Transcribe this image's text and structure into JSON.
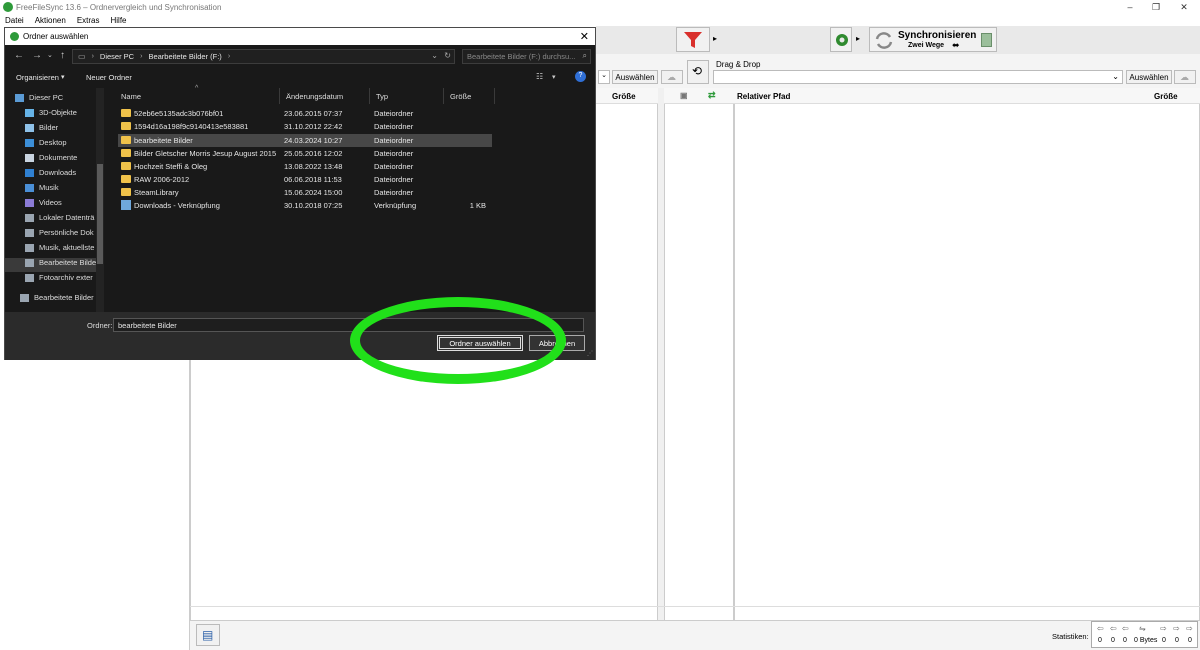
{
  "app": {
    "title": "FreeFileSync 13.6 – Ordnervergleich und Synchronisation",
    "menu": [
      "Datei",
      "Aktionen",
      "Extras",
      "Hilfe"
    ],
    "window_controls": {
      "minimize": "–",
      "maximize": "❐",
      "close": "✕"
    }
  },
  "toolbar": {
    "sync_label": "Synchronisieren",
    "sync_sub": "Zwei Wege",
    "browse_label": "Auswählen",
    "drag_drop": "Drag & Drop"
  },
  "left_grid": {
    "size_header": "Größe"
  },
  "right_grid": {
    "relpath_header": "Relativer Pfad",
    "size_header": "Größe"
  },
  "status": {
    "label": "Statistiken:",
    "counts": [
      "0",
      "0",
      "0",
      "0 Bytes",
      "0",
      "0",
      "0"
    ]
  },
  "dialog": {
    "title": "Ordner auswählen",
    "breadcrumb": [
      "Dieser PC",
      "Bearbeitete Bilder (F:)"
    ],
    "search_placeholder": "Bearbeitete Bilder (F:) durchsu...",
    "organize": "Organisieren",
    "new_folder": "Neuer Ordner",
    "help": "?",
    "nav_items": [
      "Dieser PC",
      "3D-Objekte",
      "Bilder",
      "Desktop",
      "Dokumente",
      "Downloads",
      "Musik",
      "Videos",
      "Lokaler Datenträ",
      "Persönliche Dok",
      "Musik, aktuellste",
      "Bearbeitete Bilde",
      "Fotoarchiv exter",
      "Bearbeitete Bilder"
    ],
    "columns": [
      "Name",
      "Änderungsdatum",
      "Typ",
      "Größe"
    ],
    "files": [
      {
        "name": "52eb6e5135adc3b076bf01",
        "date": "23.06.2015 07:37",
        "type": "Dateiordner",
        "size": ""
      },
      {
        "name": "1594d16a198f9c9140413e583881",
        "date": "31.10.2012 22:42",
        "type": "Dateiordner",
        "size": ""
      },
      {
        "name": "bearbeitete Bilder",
        "date": "24.03.2024 10:27",
        "type": "Dateiordner",
        "size": ""
      },
      {
        "name": "Bilder Gletscher Morris Jesup August 2015",
        "date": "25.05.2016 12:02",
        "type": "Dateiordner",
        "size": ""
      },
      {
        "name": "Hochzeit Steffi & Oleg",
        "date": "13.08.2022 13:48",
        "type": "Dateiordner",
        "size": ""
      },
      {
        "name": "RAW 2006-2012",
        "date": "06.06.2018 11:53",
        "type": "Dateiordner",
        "size": ""
      },
      {
        "name": "SteamLibrary",
        "date": "15.06.2024 15:00",
        "type": "Dateiordner",
        "size": ""
      },
      {
        "name": "Downloads - Verknüpfung",
        "date": "30.10.2018 07:25",
        "type": "Verknüpfung",
        "size": "1 KB"
      }
    ],
    "folder_label": "Ordner:",
    "folder_value": "bearbeitete Bilder",
    "ok_button": "Ordner auswählen",
    "cancel_button": "Abbrechen"
  },
  "colors": {
    "highlight": "#21e01a",
    "dialog_bg": "#191919",
    "folder": "#f0c24a"
  }
}
